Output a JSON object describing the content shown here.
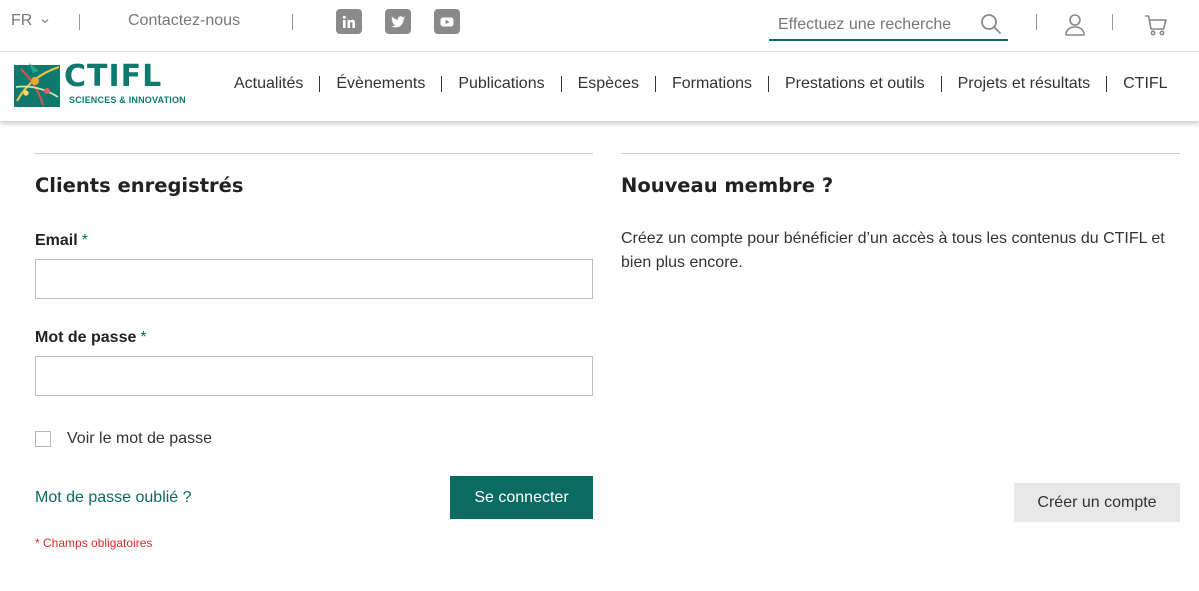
{
  "topbar": {
    "language": "FR",
    "contact": "Contactez-nous",
    "social": [
      "linkedin-icon",
      "twitter-icon",
      "youtube-icon"
    ],
    "search_placeholder": "Effectuez une recherche"
  },
  "header": {
    "logo": {
      "name": "CTIFL",
      "tagline": "SCIENCES & INNOVATION"
    },
    "nav": [
      "Actualités",
      "Évènements",
      "Publications",
      "Espèces",
      "Formations",
      "Prestations et outils",
      "Projets et résultats",
      "CTIFL"
    ]
  },
  "login": {
    "title": "Clients enregistrés",
    "email_label": "Email",
    "email_value": "",
    "password_label": "Mot de passe",
    "password_value": "",
    "required_mark": "*",
    "show_password": "Voir le mot de passe",
    "forgot": "Mot de passe oublié ?",
    "submit": "Se connecter",
    "required_note": "* Champs obligatoires"
  },
  "register": {
    "title": "Nouveau membre ?",
    "description": "Créez un compte pour bénéficier d’un accès à tous les contenus du CTIFL et bien plus encore.",
    "button": "Créer un compte"
  },
  "colors": {
    "accent": "#0a6b63",
    "required_note": "#e02b27",
    "secondary_button": "#e8e8e8"
  }
}
